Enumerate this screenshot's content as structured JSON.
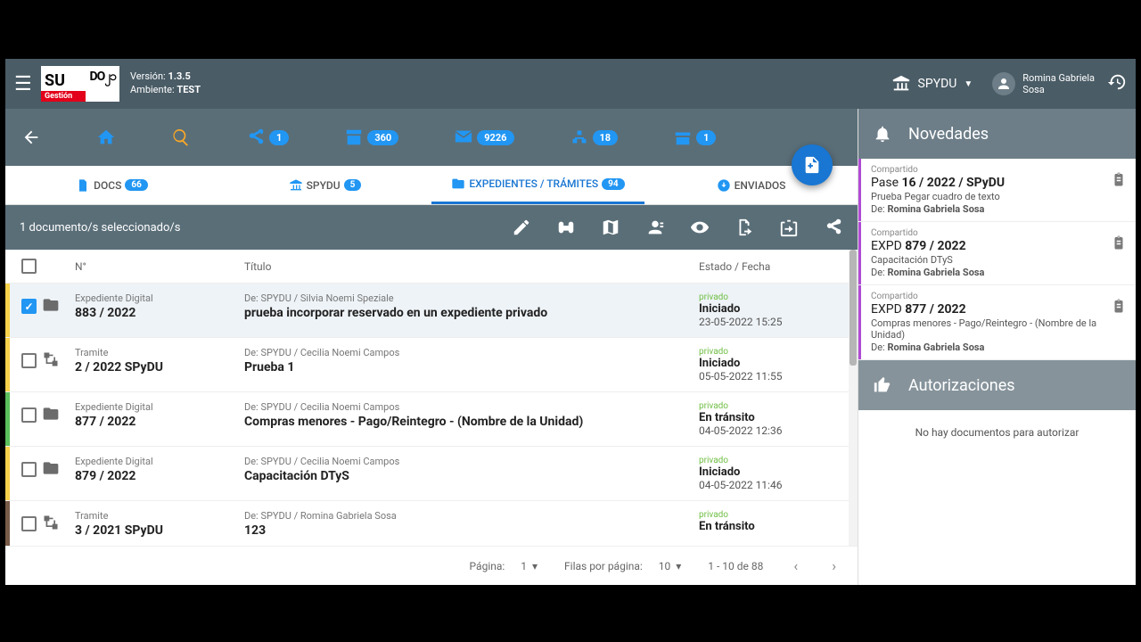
{
  "env": {
    "version_label": "Versión:",
    "version": "1.3.5",
    "ambiente_label": "Ambiente:",
    "ambiente": "TEST"
  },
  "org": "SPYDU",
  "user": {
    "line1": "Romina Gabriela",
    "line2": "Sosa"
  },
  "iconbar": {
    "share": "1",
    "archive": "360",
    "inbox": "9226",
    "dist": "18",
    "box": "1"
  },
  "tabs": {
    "docs": {
      "label": "DOCS",
      "count": "66"
    },
    "spydu": {
      "label": "SPYDU",
      "count": "5"
    },
    "exped": {
      "label": "EXPEDIENTES / TRÁMITES",
      "count": "94"
    },
    "env": {
      "label": "ENVIADOS"
    }
  },
  "selbar": {
    "text": "1 documento/s seleccionado/s"
  },
  "cols": {
    "no": "N°",
    "titulo": "Título",
    "estado": "Estado / Fecha"
  },
  "rows": [
    {
      "checked": true,
      "stripe": "#f9d24a",
      "icon": "folder",
      "type": "Expediente Digital",
      "num": "883 / 2022",
      "from": "De: SPYDU / Silvia Noemi Speziale",
      "title": "prueba incorporar reservado en un expediente privado",
      "priv": "privado",
      "state": "Iniciado",
      "date": "23-05-2022 15:25"
    },
    {
      "checked": false,
      "stripe": "#f9d24a",
      "icon": "flow",
      "type": "Tramite",
      "num": "2 / 2022 SPyDU",
      "from": "De: SPYDU / Cecilia Noemi Campos",
      "title": "Prueba 1",
      "priv": "privado",
      "state": "Iniciado",
      "date": "05-05-2022 11:55"
    },
    {
      "checked": false,
      "stripe": "#5bbf5b",
      "icon": "folder",
      "type": "Expediente Digital",
      "num": "877 / 2022",
      "from": "De: SPYDU / Cecilia Noemi Campos",
      "title": "Compras menores - Pago/Reintegro - (Nombre de la Unidad)",
      "priv": "privado",
      "state": "En tránsito",
      "date": "04-05-2022 12:36"
    },
    {
      "checked": false,
      "stripe": "#f9d24a",
      "icon": "folder",
      "type": "Expediente Digital",
      "num": "879 / 2022",
      "from": "De: SPYDU / Cecilia Noemi Campos",
      "title": "Capacitación DTyS",
      "priv": "privado",
      "state": "Iniciado",
      "date": "04-05-2022 11:46"
    },
    {
      "checked": false,
      "stripe": "#7a5b4a",
      "icon": "flow",
      "type": "Tramite",
      "num": "3 / 2021 SPyDU",
      "from": "De: SPYDU / Romina Gabriela Sosa",
      "title": "123",
      "priv": "privado",
      "state": "En tránsito",
      "date": ""
    }
  ],
  "pager": {
    "page_lbl": "Página:",
    "page": "1",
    "rows_lbl": "Filas por página:",
    "rows": "10",
    "range": "1 - 10 de 88"
  },
  "right": {
    "novedades": "Novedades",
    "autoriz": "Autorizaciones",
    "auth_empty": "No hay documentos para autorizar",
    "items": [
      {
        "tag": "Compartido",
        "title_pre": "Pase ",
        "title_b": "16 / 2022 / SPyDU",
        "sub": "Prueba Pegar cuadro de texto",
        "from": "De: Romina Gabriela Sosa"
      },
      {
        "tag": "Compartido",
        "title_pre": "EXPD ",
        "title_b": "879 / 2022",
        "sub": "Capacitación DTyS",
        "from": "De: Romina Gabriela Sosa"
      },
      {
        "tag": "Compartido",
        "title_pre": "EXPD ",
        "title_b": "877 / 2022",
        "sub": "Compras menores - Pago/Reintegro - (Nombre de la Unidad)",
        "from": "De: Romina Gabriela Sosa"
      }
    ]
  }
}
